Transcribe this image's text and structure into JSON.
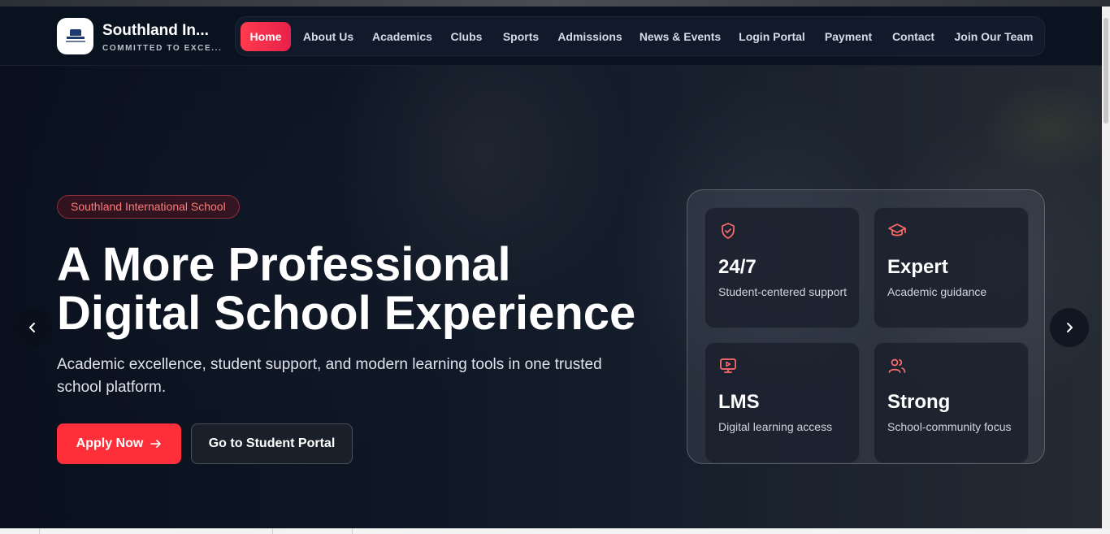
{
  "brand": {
    "name": "Southland In...",
    "tagline": "COMMITTED TO EXCE..."
  },
  "nav": {
    "items": [
      {
        "label": "Home",
        "active": true
      },
      {
        "label": "About Us"
      },
      {
        "label": "Academics"
      },
      {
        "label": "Clubs"
      },
      {
        "label": "Sports"
      },
      {
        "label": "Admissions"
      },
      {
        "label": "News & Events"
      },
      {
        "label": "Login Portal"
      },
      {
        "label": "Payment"
      },
      {
        "label": "Contact"
      },
      {
        "label": "Join Our Team"
      }
    ]
  },
  "hero": {
    "badge": "Southland International School",
    "headline_line1": "A More Professional",
    "headline_line2": "Digital School Experience",
    "subtext": "Academic excellence, student support, and modern learning tools in one trusted school platform.",
    "apply_label": "Apply Now",
    "portal_label": "Go to Student Portal"
  },
  "stats": [
    {
      "icon": "shield-check-icon",
      "value": "24/7",
      "desc": "Student-centered support"
    },
    {
      "icon": "graduation-cap-icon",
      "value": "Expert",
      "desc": "Academic guidance"
    },
    {
      "icon": "monitor-play-icon",
      "value": "LMS",
      "desc": "Digital learning access"
    },
    {
      "icon": "users-icon",
      "value": "Strong",
      "desc": "School-community focus"
    }
  ],
  "colors": {
    "accent": "#ff2f3a",
    "accent_text": "#ff7b7b",
    "background": "#0b1424"
  }
}
